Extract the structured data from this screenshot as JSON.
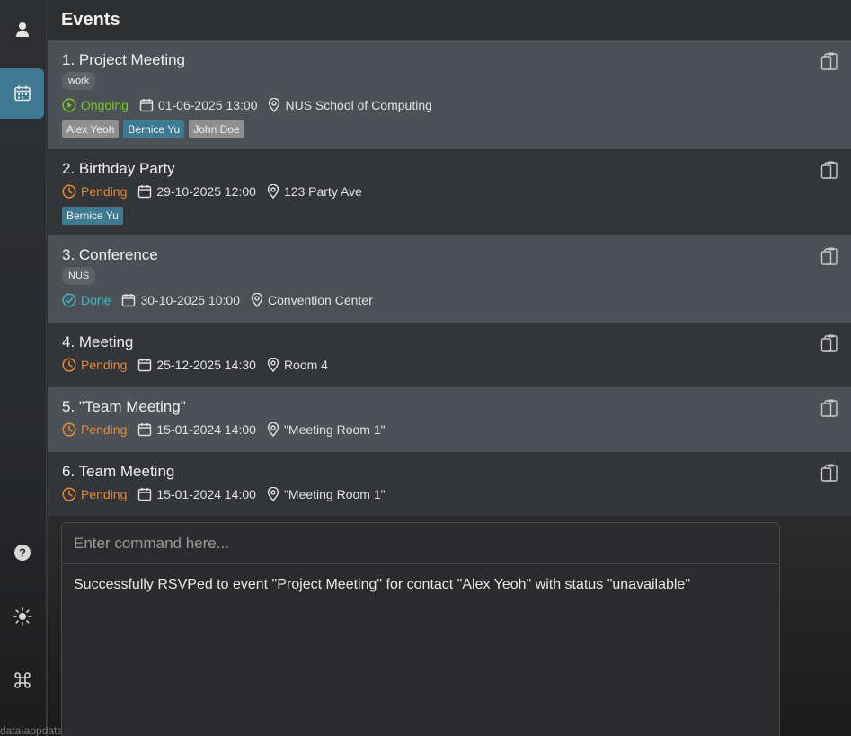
{
  "header": {
    "title": "Events"
  },
  "sidebar": {
    "items": [
      {
        "name": "contacts",
        "icon": "person-icon",
        "active": false
      },
      {
        "name": "events",
        "icon": "calendar-icon",
        "active": true
      },
      {
        "name": "help",
        "icon": "help-icon",
        "active": false
      },
      {
        "name": "theme",
        "icon": "sun-icon",
        "active": false
      },
      {
        "name": "commands",
        "icon": "command-icon",
        "active": false
      }
    ]
  },
  "events": [
    {
      "title": "1. Project Meeting",
      "tag": "work",
      "status": "Ongoing",
      "datetime": "01-06-2025 13:00",
      "location": "NUS School of Computing",
      "attendees": [
        {
          "name": "Alex Yeoh",
          "color": "grey"
        },
        {
          "name": "Bernice Yu",
          "color": "blue"
        },
        {
          "name": "John Doe",
          "color": "grey"
        }
      ]
    },
    {
      "title": "2. Birthday Party",
      "status": "Pending",
      "datetime": "29-10-2025 12:00",
      "location": "123 Party Ave",
      "attendees": [
        {
          "name": "Bernice Yu",
          "color": "blue"
        }
      ]
    },
    {
      "title": "3. Conference",
      "tag": "NUS",
      "status": "Done",
      "datetime": "30-10-2025 10:00",
      "location": "Convention Center"
    },
    {
      "title": "4. Meeting",
      "status": "Pending",
      "datetime": "25-12-2025 14:30",
      "location": "Room 4"
    },
    {
      "title": "5. \"Team Meeting\"",
      "status": "Pending",
      "datetime": "15-01-2024 14:00",
      "location": "\"Meeting Room 1\""
    },
    {
      "title": "6. Team Meeting",
      "status": "Pending",
      "datetime": "15-01-2024 14:00",
      "location": "\"Meeting Room 1\""
    }
  ],
  "command": {
    "placeholder": "Enter command here...",
    "value": ""
  },
  "result": "Successfully RSVPed to event \"Project Meeting\" for contact \"Alex Yeoh\" with status \"unavailable\"",
  "status_bar": {
    "path": "data\\appdata"
  },
  "colors": {
    "ongoing": "#7ec234",
    "pending": "#e08b3a",
    "done": "#3fb8c9",
    "accent": "#3f7a93"
  }
}
